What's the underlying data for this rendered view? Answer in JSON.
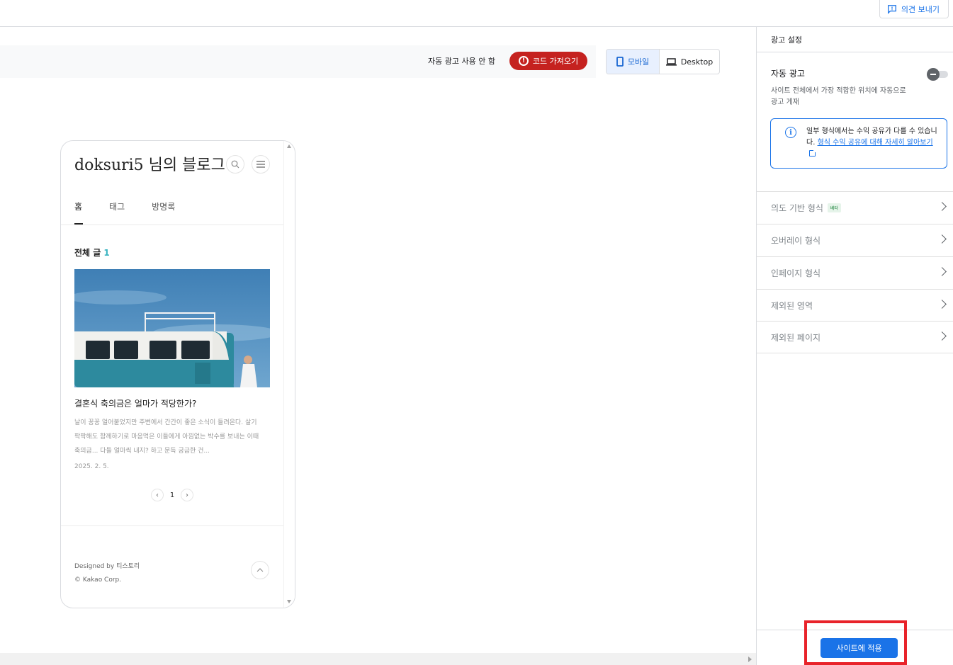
{
  "topbar": {
    "feedback_label": "의견 보내기"
  },
  "toolbar": {
    "auto_ads_status": "자동 광고 사용 안 함",
    "get_code_label": "코드 가져오기",
    "device_mobile": "모바일",
    "device_desktop": "Desktop"
  },
  "preview": {
    "blog_title": "doksuri5 님의 블로그",
    "tabs": [
      "홈",
      "태그",
      "방명록"
    ],
    "all_posts_label": "전체 글",
    "all_posts_count": "1",
    "post": {
      "title": "결혼식 축의금은 얼마가 적당한가?",
      "excerpt": "날이 꽁꽁 얼어붙었지만 주변에서 간간이 좋은 소식이 들려온다. 살기 팍팍해도 함께하기로 마음먹은 이들에게 아낌없는 박수를 보내는 이때축의금... 다들 얼마씩 내지? 하고 문득 궁금한 건...",
      "date": "2025. 2. 5."
    },
    "page_number": "1",
    "footer_designed": "Designed by 티스토리",
    "footer_copyright": "© Kakao Corp."
  },
  "panel": {
    "header": "광고 설정",
    "auto_ads_title": "자동 광고",
    "auto_ads_enabled": false,
    "auto_ads_desc": "사이트 전체에서 가장 적합한 위치에 자동으로 광고 게재",
    "info_text": "일부 형식에서는 수익 공유가 다를 수 있습니다.",
    "info_link": "형식 수익 공유에 대해 자세히 알아보기",
    "sections": [
      {
        "label": "의도 기반 형식",
        "badge": "베타"
      },
      {
        "label": "오버레이 형식"
      },
      {
        "label": "인페이지 형식"
      },
      {
        "label": "제외된 영역"
      },
      {
        "label": "제외된 페이지"
      }
    ],
    "apply_label": "사이트에 적용"
  },
  "colors": {
    "accent": "#1a73e8",
    "danger": "#c5221f",
    "highlight": "#e8232a"
  }
}
